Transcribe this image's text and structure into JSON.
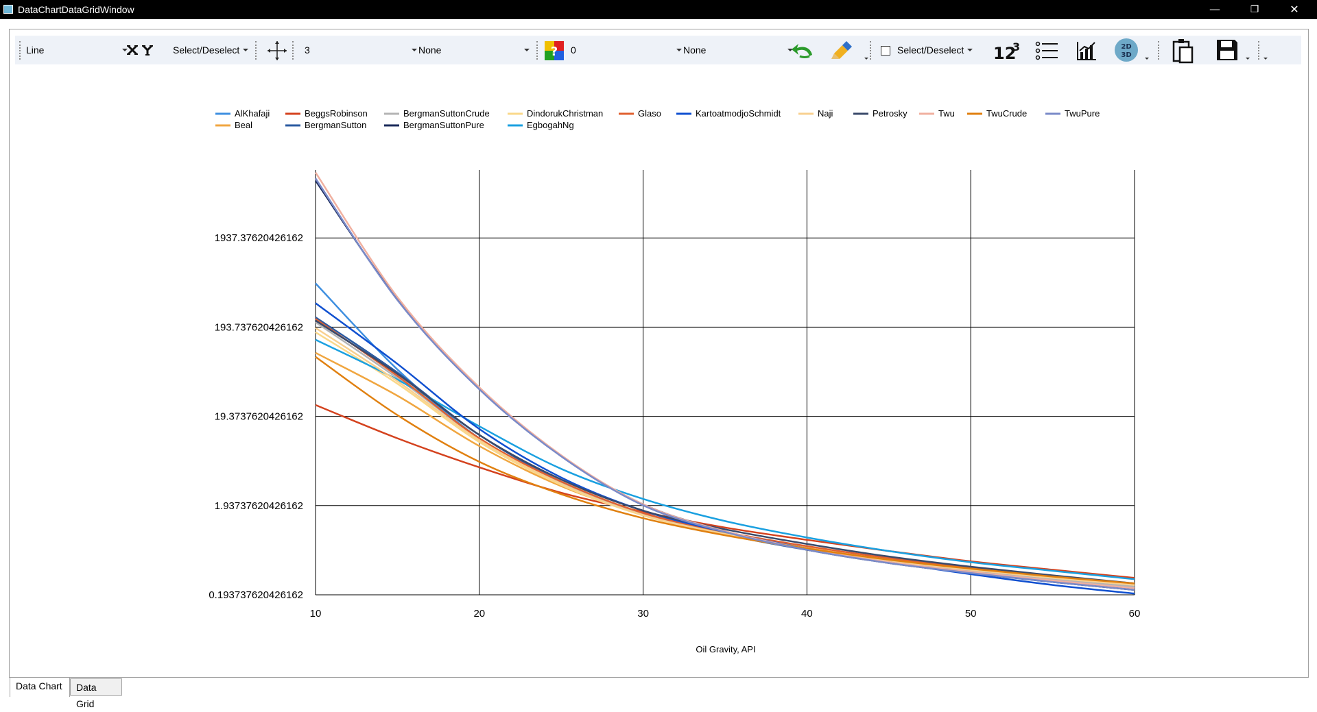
{
  "window": {
    "title": "DataChartDataGridWindow",
    "minimize_glyph": "—",
    "restore_glyph": "❐",
    "close_glyph": "✕"
  },
  "toolbar": {
    "chart_type_value": "Line",
    "select_deselect_label": "Select/Deselect",
    "line_width_value": "3",
    "marker_value": "None",
    "label_value": "0",
    "label_position_value": "None",
    "checkbox_select_label": "Select/Deselect",
    "checkbox_checked": false,
    "icons": [
      "x-axis-icon",
      "y-axis-icon",
      "move-crosshair-icon",
      "random-color-icon",
      "reset-arrow-icon",
      "paint-brush-icon",
      "number-format-icon",
      "legend-list-icon",
      "chart-line-icon",
      "2d-3d-toggle-icon",
      "copy-clipboard-icon",
      "save-disk-icon"
    ]
  },
  "tabs": [
    {
      "label": "Data Chart",
      "active": true
    },
    {
      "label": "Data Grid",
      "active": false
    }
  ],
  "chart_data": {
    "type": "line",
    "title": "",
    "xlabel": "Oil Gravity, API",
    "ylabel": "",
    "yscale": "log",
    "xlim": [
      10,
      60
    ],
    "x_ticks": [
      10,
      20,
      30,
      40,
      50,
      60
    ],
    "y_ticks": [
      "0.193737620426162",
      "1.93737620426162",
      "19.3737620426162",
      "193.737620426162",
      "1937.37620426162"
    ],
    "grid": true,
    "legend_position": "top",
    "x": [
      10,
      15,
      20,
      25,
      30,
      35,
      40,
      45,
      50,
      55,
      60
    ],
    "series": [
      {
        "name": "AlKhafaji",
        "color": "#3e8fe0",
        "values": [
          600,
          65,
          11,
          3.4,
          1.6,
          0.95,
          0.62,
          0.45,
          0.34,
          0.27,
          0.22
        ]
      },
      {
        "name": "Beal",
        "color": "#f0a640",
        "values": [
          100,
          33,
          9,
          3.2,
          1.55,
          0.95,
          0.65,
          0.48,
          0.38,
          0.31,
          0.26
        ]
      },
      {
        "name": "BeggsRobinson",
        "color": "#d4421e",
        "values": [
          26,
          11,
          5.2,
          2.7,
          1.65,
          1.1,
          0.8,
          0.6,
          0.46,
          0.37,
          0.3
        ]
      },
      {
        "name": "BergmanSutton",
        "color": "#2a5aa0",
        "values": [
          250,
          60,
          12,
          3.6,
          1.55,
          0.92,
          0.62,
          0.46,
          0.36,
          0.29,
          0.24
        ]
      },
      {
        "name": "BergmanSuttonCrude",
        "color": "#b4b4b4",
        "values": [
          220,
          52,
          11,
          3.5,
          1.55,
          0.93,
          0.63,
          0.46,
          0.36,
          0.29,
          0.24
        ]
      },
      {
        "name": "BergmanSuttonPure",
        "color": "#1a2a5a",
        "values": [
          8500,
          400,
          40,
          7,
          2.0,
          1.0,
          0.62,
          0.44,
          0.34,
          0.27,
          0.22
        ]
      },
      {
        "name": "DindorukChristman",
        "color": "#fad88a",
        "values": [
          170,
          45,
          10,
          3.3,
          1.5,
          0.92,
          0.63,
          0.47,
          0.37,
          0.3,
          0.25
        ]
      },
      {
        "name": "EgbogahNg",
        "color": "#1aa0e0",
        "values": [
          140,
          50,
          15,
          5,
          2.3,
          1.3,
          0.85,
          0.6,
          0.45,
          0.36,
          0.29
        ]
      },
      {
        "name": "Glaso",
        "color": "#e06030",
        "values": [
          240,
          55,
          11,
          3.6,
          1.6,
          0.98,
          0.68,
          0.5,
          0.39,
          0.31,
          0.26
        ]
      },
      {
        "name": "KartoatmodjoSchmidt",
        "color": "#1050d0",
        "values": [
          360,
          75,
          14,
          4.0,
          1.7,
          0.98,
          0.64,
          0.45,
          0.33,
          0.25,
          0.2
        ]
      },
      {
        "name": "Naji",
        "color": "#f8d090",
        "values": [
          190,
          48,
          10.5,
          3.4,
          1.52,
          0.93,
          0.64,
          0.47,
          0.37,
          0.3,
          0.25
        ]
      },
      {
        "name": "Petrosky",
        "color": "#3a4a6a",
        "values": [
          230,
          58,
          12,
          3.8,
          1.7,
          1.05,
          0.72,
          0.52,
          0.4,
          0.32,
          0.26
        ]
      },
      {
        "name": "Twu",
        "color": "#f0b0a0",
        "values": [
          10500,
          420,
          41,
          7.1,
          2.0,
          1.0,
          0.63,
          0.45,
          0.35,
          0.28,
          0.23
        ]
      },
      {
        "name": "TwuCrude",
        "color": "#e08010",
        "values": [
          90,
          20,
          6,
          2.6,
          1.4,
          0.9,
          0.64,
          0.48,
          0.38,
          0.31,
          0.26
        ]
      },
      {
        "name": "TwuPure",
        "color": "#7a8ac8",
        "values": [
          9000,
          390,
          39,
          6.9,
          1.95,
          0.98,
          0.62,
          0.44,
          0.34,
          0.27,
          0.22
        ]
      }
    ]
  }
}
